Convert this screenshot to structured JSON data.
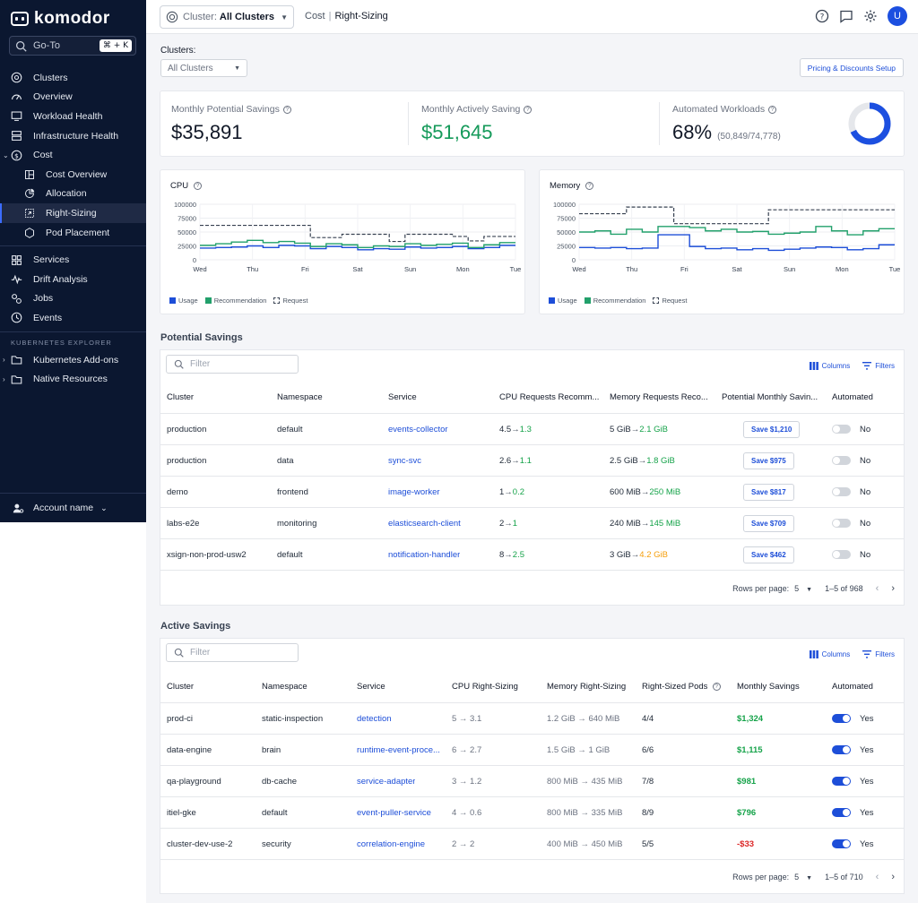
{
  "app": {
    "name": "komodor"
  },
  "sidebar": {
    "goto": {
      "label": "Go-To",
      "shortcut": "⌘ + K"
    },
    "items": [
      {
        "label": "Clusters",
        "icon": "clusters-icon"
      },
      {
        "label": "Overview",
        "icon": "gauge-icon"
      },
      {
        "label": "Workload Health",
        "icon": "monitor-icon"
      },
      {
        "label": "Infrastructure Health",
        "icon": "server-icon"
      },
      {
        "label": "Cost",
        "icon": "dollar-icon"
      },
      {
        "label": "Cost Overview",
        "icon": "layout-icon"
      },
      {
        "label": "Allocation",
        "icon": "pie-icon"
      },
      {
        "label": "Right-Sizing",
        "icon": "resize-icon"
      },
      {
        "label": "Pod Placement",
        "icon": "pod-icon"
      },
      {
        "label": "Services",
        "icon": "grid-icon"
      },
      {
        "label": "Drift Analysis",
        "icon": "drift-icon"
      },
      {
        "label": "Jobs",
        "icon": "jobs-icon"
      },
      {
        "label": "Events",
        "icon": "clock-icon"
      }
    ],
    "explorer_label": "KUBERNETES EXPLORER",
    "explorer_items": [
      {
        "label": "Kubernetes Add-ons",
        "icon": "folder-icon"
      },
      {
        "label": "Native Resources",
        "icon": "folder-icon"
      }
    ],
    "account": {
      "label": "Account name"
    }
  },
  "topbar": {
    "cluster_prefix": "Cluster:",
    "cluster_value": "All Clusters",
    "breadcrumb": [
      "Cost",
      "Right-Sizing"
    ],
    "avatar": "U"
  },
  "filters": {
    "clusters_label": "Clusters:",
    "clusters_value": "All Clusters",
    "pricing_button": "Pricing & Discounts Setup"
  },
  "kpis": {
    "potential": {
      "title": "Monthly Potential Savings",
      "value": "$35,891"
    },
    "active": {
      "title": "Monthly Actively Saving",
      "value": "$51,645"
    },
    "automated": {
      "title": "Automated Workloads",
      "value": "68%",
      "detail": "(50,849/74,778)",
      "fraction": 0.68
    }
  },
  "colors": {
    "usage": "#1d4ed8",
    "recommendation": "#22a06b",
    "request": "#374151",
    "accent": "#1c4fe0"
  },
  "chart_data": [
    {
      "type": "line",
      "title": "CPU",
      "categories": [
        "Wed",
        "Thu",
        "Fri",
        "Sat",
        "Sun",
        "Mon",
        "Tue"
      ],
      "ylim": [
        0,
        100000
      ],
      "yticks": [
        0,
        25000,
        50000,
        75000,
        100000
      ],
      "series": [
        {
          "name": "Usage",
          "values": [
            21000,
            22000,
            23000,
            25000,
            22000,
            26000,
            25000,
            20000,
            24000,
            22000,
            18000,
            20000,
            19000,
            23000,
            21000,
            22000,
            24000,
            20000,
            22000,
            26000
          ]
        },
        {
          "name": "Recommendation",
          "values": [
            26000,
            29000,
            32000,
            35000,
            31000,
            33000,
            30000,
            24000,
            29000,
            27000,
            22000,
            25000,
            24000,
            29000,
            26000,
            28000,
            30000,
            22000,
            27000,
            31000
          ]
        },
        {
          "name": "Request",
          "values": [
            62000,
            62000,
            62000,
            62000,
            62000,
            62000,
            62000,
            40000,
            40000,
            46000,
            46000,
            46000,
            33000,
            46000,
            46000,
            46000,
            42000,
            34000,
            42000,
            42000
          ]
        }
      ]
    },
    {
      "type": "line",
      "title": "Memory",
      "categories": [
        "Wed",
        "Thu",
        "Fri",
        "Sat",
        "Sun",
        "Mon",
        "Tue"
      ],
      "ylim": [
        0,
        100000
      ],
      "yticks": [
        0,
        25000,
        50000,
        75000,
        100000
      ],
      "series": [
        {
          "name": "Usage",
          "values": [
            22000,
            21000,
            22000,
            20000,
            21000,
            45000,
            45000,
            24000,
            20000,
            21000,
            18000,
            20000,
            17000,
            19000,
            21000,
            23000,
            22000,
            18000,
            20000,
            27000
          ]
        },
        {
          "name": "Recommendation",
          "values": [
            50000,
            52000,
            46000,
            55000,
            50000,
            60000,
            60000,
            58000,
            52000,
            55000,
            50000,
            51000,
            46000,
            48000,
            50000,
            60000,
            52000,
            45000,
            52000,
            56000
          ]
        },
        {
          "name": "Request",
          "values": [
            83000,
            83000,
            83000,
            95000,
            95000,
            95000,
            65000,
            65000,
            65000,
            65000,
            65000,
            65000,
            90000,
            90000,
            90000,
            90000,
            90000,
            90000,
            90000,
            90000
          ]
        }
      ]
    }
  ],
  "legend": [
    "Usage",
    "Recommendation",
    "Request"
  ],
  "potential": {
    "title": "Potential Savings",
    "filter_placeholder": "Filter",
    "columns_label": "Columns",
    "filters_label": "Filters",
    "headers": [
      "Cluster",
      "Namespace",
      "Service",
      "CPU Requests Recomm...",
      "Memory Requests Reco...",
      "Potential Monthly Savin...",
      "Automated"
    ],
    "rows": [
      {
        "cluster": "production",
        "namespace": "default",
        "service": "events-collector",
        "cpu_from": "4.5",
        "cpu_to": "1.3",
        "mem_from": "5 GiB",
        "mem_to": "2.1 GiB",
        "mem_warn": false,
        "save": "Save $1,210",
        "automated": "No"
      },
      {
        "cluster": "production",
        "namespace": "data",
        "service": "sync-svc",
        "cpu_from": "2.6",
        "cpu_to": "1.1",
        "mem_from": "2.5 GiB",
        "mem_to": "1.8 GiB",
        "mem_warn": false,
        "save": "Save $975",
        "automated": "No"
      },
      {
        "cluster": "demo",
        "namespace": "frontend",
        "service": "image-worker",
        "cpu_from": "1",
        "cpu_to": "0.2",
        "mem_from": "600 MiB",
        "mem_to": "250 MiB",
        "mem_warn": false,
        "save": "Save $817",
        "automated": "No"
      },
      {
        "cluster": "labs-e2e",
        "namespace": "monitoring",
        "service": "elasticsearch-client",
        "cpu_from": "2",
        "cpu_to": "1",
        "mem_from": "240 MiB",
        "mem_to": "145 MiB",
        "mem_warn": false,
        "save": "Save $709",
        "automated": "No"
      },
      {
        "cluster": "xsign-non-prod-usw2",
        "namespace": "default",
        "service": "notification-handler",
        "cpu_from": "8",
        "cpu_to": "2.5",
        "mem_from": "3 GiB",
        "mem_to": "4.2 GiB",
        "mem_warn": true,
        "save": "Save $462",
        "automated": "No"
      }
    ],
    "rows_per_page_label": "Rows per page:",
    "rows_per_page": "5",
    "range": "1–5 of 968"
  },
  "active": {
    "title": "Active Savings",
    "filter_placeholder": "Filter",
    "columns_label": "Columns",
    "filters_label": "Filters",
    "headers": [
      "Cluster",
      "Namespace",
      "Service",
      "CPU Right-Sizing",
      "Memory Right-Sizing",
      "Right-Sized Pods",
      "Monthly Savings",
      "Automated"
    ],
    "rows": [
      {
        "cluster": "prod-ci",
        "namespace": "static-inspection",
        "service": "detection",
        "cpu": "5 → 3.1",
        "mem": "1.2 GiB → 640 MiB",
        "pods": "4/4",
        "savings": "$1,324",
        "neg": false,
        "automated": "Yes"
      },
      {
        "cluster": "data-engine",
        "namespace": "brain",
        "service": "runtime-event-proce...",
        "cpu": "6 → 2.7",
        "mem": "1.5 GiB → 1 GiB",
        "pods": "6/6",
        "savings": "$1,115",
        "neg": false,
        "automated": "Yes"
      },
      {
        "cluster": "qa-playground",
        "namespace": "db-cache",
        "service": "service-adapter",
        "cpu": "3 → 1.2",
        "mem": "800 MiB → 435 MiB",
        "pods": "7/8",
        "savings": "$981",
        "neg": false,
        "automated": "Yes"
      },
      {
        "cluster": "itiel-gke",
        "namespace": "default",
        "service": "event-puller-service",
        "cpu": "4 → 0.6",
        "mem": "800 MiB → 335 MiB",
        "pods": "8/9",
        "savings": "$796",
        "neg": false,
        "automated": "Yes"
      },
      {
        "cluster": "cluster-dev-use-2",
        "namespace": "security",
        "service": "correlation-engine",
        "cpu": "2 → 2",
        "mem": "400 MiB → 450 MiB",
        "pods": "5/5",
        "savings": "-$33",
        "neg": true,
        "automated": "Yes"
      }
    ],
    "rows_per_page_label": "Rows per page:",
    "rows_per_page": "5",
    "range": "1–5 of 710"
  }
}
